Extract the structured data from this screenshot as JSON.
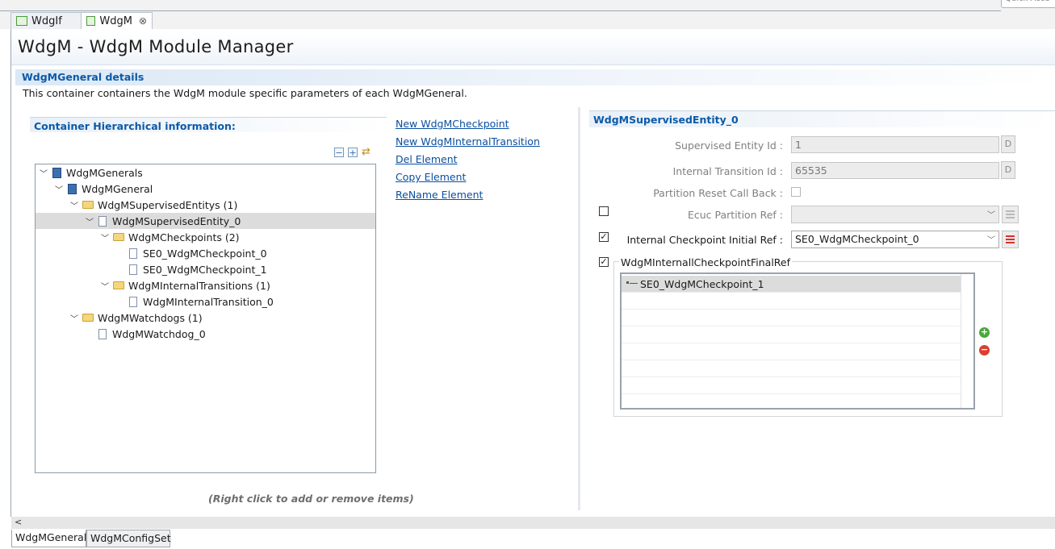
{
  "editor_tabs": [
    {
      "label": "WdgIf",
      "close": ""
    },
    {
      "label": "WdgM",
      "close": "⊗"
    }
  ],
  "quick_access": "Quick Acce",
  "header": {
    "title": "WdgM - WdgM Module Manager"
  },
  "section": {
    "title": "WdgMGeneral details",
    "description": "This container containers the WdgM module specific parameters of each WdgMGeneral."
  },
  "hierarchy": {
    "title": "Container Hierarchical information:",
    "toolbar_icons": [
      "collapse-all-icon",
      "expand-all-icon",
      "link-with-editor-icon"
    ],
    "hint": "(Right click to add or remove items)",
    "nodes": [
      {
        "label": "WdgMGenerals"
      },
      {
        "label": "WdgMGeneral"
      },
      {
        "label": "WdgMSupervisedEntitys (1)"
      },
      {
        "label": "WdgMSupervisedEntity_0"
      },
      {
        "label": "WdgMCheckpoints (2)"
      },
      {
        "label": "SE0_WdgMCheckpoint_0"
      },
      {
        "label": "SE0_WdgMCheckpoint_1"
      },
      {
        "label": "WdgMInternalTransitions (1)"
      },
      {
        "label": "WdgMInternalTransition_0"
      },
      {
        "label": "WdgMWatchdogs (1)"
      },
      {
        "label": "WdgMWatchdog_0"
      }
    ]
  },
  "actions": [
    "New WdgMCheckpoint",
    "New WdgMInternalTransition",
    "Del Element",
    "Copy Element",
    "ReName Element"
  ],
  "details": {
    "title": "WdgMSupervisedEntity_0",
    "supervised_entity_id": {
      "label": "Supervised Entity Id :",
      "value": "1",
      "button": "D"
    },
    "internal_transition_id": {
      "label": "Internal Transition Id :",
      "value": "65535",
      "button": "D"
    },
    "partition_reset": {
      "label": "Partition Reset Call Back :"
    },
    "ecuc_partition_ref": {
      "label": "Ecuc Partition Ref :",
      "value": ""
    },
    "internal_checkpoint_initial_ref": {
      "label": "Internal Checkpoint Initial Ref :",
      "value": "SE0_WdgMCheckpoint_0",
      "check": "✓"
    },
    "final_ref": {
      "label": "WdgMInternallCheckpointFinalRef",
      "check": "✓",
      "items": [
        "SE0_WdgMCheckpoint_1"
      ],
      "add": "+",
      "remove": "−"
    }
  },
  "bottom": {
    "scroll_left": "<",
    "tabs": [
      "WdgMGeneral",
      "WdgMConfigSet"
    ]
  }
}
